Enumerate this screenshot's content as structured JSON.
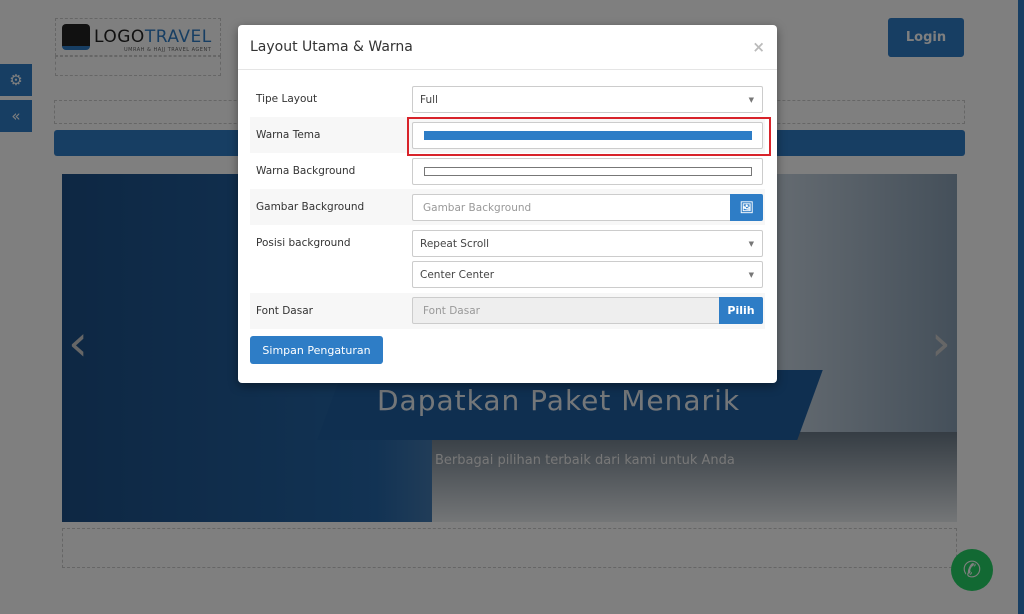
{
  "site": {
    "logo_text_a": "LOGO",
    "logo_text_b": "TRAVEL",
    "logo_tagline": "UMRAH & HAJJ TRAVEL AGENT",
    "login_label": "Login",
    "hero_title": "Dapatkan Paket Menarik",
    "hero_subtitle": "Berbagai pilihan terbaik dari kami untuk Anda"
  },
  "sidebar": {
    "items": [
      {
        "icon": "gears-icon"
      },
      {
        "icon": "double-chevron-left-icon"
      }
    ]
  },
  "modal": {
    "title": "Layout Utama & Warna",
    "close": "×",
    "fields": [
      {
        "label": "Tipe Layout",
        "value": "Full"
      },
      {
        "label": "Warna Tema",
        "color": "#2e7dc6"
      },
      {
        "label": "Warna Background",
        "color": "#ffffff"
      },
      {
        "label": "Gambar Background",
        "placeholder": "Gambar Background",
        "icon": "image-icon"
      },
      {
        "label": "Posisi background",
        "value": "Repeat Scroll",
        "value2": "Center Center"
      },
      {
        "label": "Font Dasar",
        "placeholder": "Font Dasar",
        "button": "Pilih"
      }
    ],
    "save_label": "Simpan Pengaturan"
  },
  "colors": {
    "accent": "#2e7dc6",
    "highlight": "#d8232a",
    "whatsapp": "#25d366"
  }
}
